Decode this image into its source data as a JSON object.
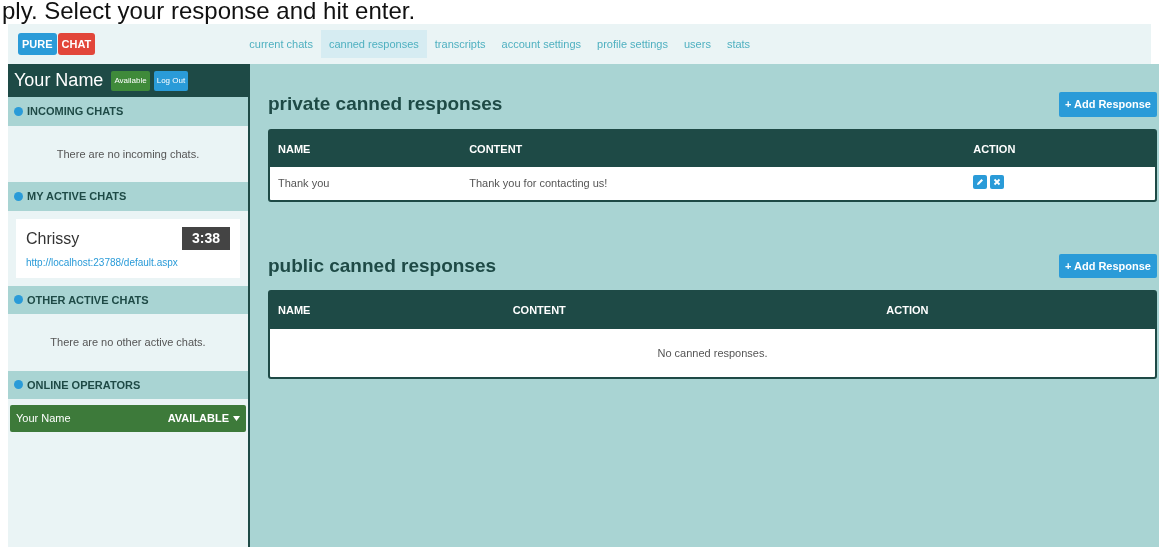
{
  "caption": "ply. Select your response and hit enter.",
  "header": {
    "logo": [
      "PURE",
      "CHAT"
    ],
    "nav": [
      {
        "label": "current chats",
        "selected": false
      },
      {
        "label": "canned responses",
        "selected": true
      },
      {
        "label": "transcripts",
        "selected": false
      },
      {
        "label": "account settings",
        "selected": false
      },
      {
        "label": "profile settings",
        "selected": false
      },
      {
        "label": "users",
        "selected": false
      },
      {
        "label": "stats",
        "selected": false
      }
    ]
  },
  "sidebar": {
    "user_name": "Your Name",
    "status_button": "Available",
    "logout_button": "Log Out",
    "sections": [
      {
        "title": "INCOMING CHATS",
        "kind": "message",
        "expanded": true,
        "text": "There are no incoming chats."
      },
      {
        "title": "MY ACTIVE CHATS",
        "kind": "chats",
        "expanded": true,
        "chats": [
          {
            "name": "Chrissy",
            "timer": "3:38",
            "url": "http://localhost:23788/default.aspx"
          }
        ]
      },
      {
        "title": "OTHER ACTIVE CHATS",
        "kind": "message",
        "expanded": true,
        "text": "There are no other active chats."
      },
      {
        "title": "ONLINE OPERATORS",
        "kind": "operators",
        "expanded": true,
        "operators": [
          {
            "name": "Your Name",
            "status": "AVAILABLE"
          }
        ]
      }
    ]
  },
  "panels": [
    {
      "title": "private canned responses",
      "add_button": "+ Add Response",
      "columns": [
        "NAME",
        "CONTENT",
        "ACTION"
      ],
      "rows": [
        {
          "name": "Thank you",
          "content": "Thank you for contacting us!"
        }
      ]
    },
    {
      "title": "public canned responses",
      "add_button": "+ Add Response",
      "columns": [
        "NAME",
        "CONTENT",
        "ACTION"
      ],
      "empty_text": "No canned responses."
    }
  ]
}
